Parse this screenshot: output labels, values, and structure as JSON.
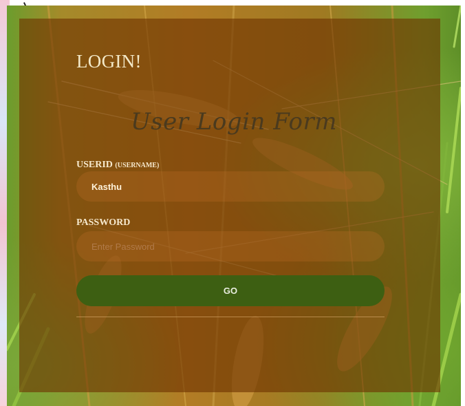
{
  "login": {
    "title": "LOGIN!",
    "form_heading": "User Login Form",
    "userid_label": "USERID",
    "userid_label_hint": "(USERNAME)",
    "userid_value": "Kasthu",
    "password_label": "PASSWORD",
    "password_placeholder": "Enter Password",
    "go_label": "GO"
  },
  "colors": {
    "panel_overlay": "#6e3200",
    "go_button": "#3d5f12"
  }
}
